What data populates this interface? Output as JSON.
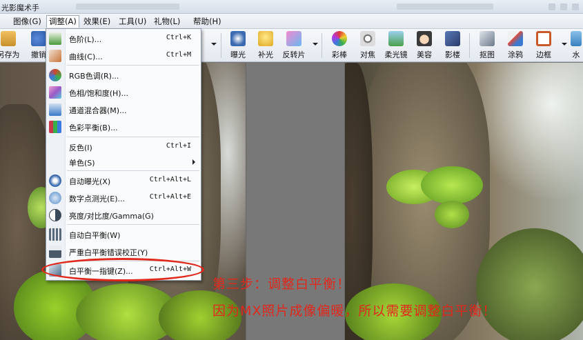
{
  "window": {
    "title": "光影魔术手"
  },
  "menubar": {
    "items": [
      {
        "label": "图像(G)"
      },
      {
        "label": "调整(A)"
      },
      {
        "label": "效果(E)"
      },
      {
        "label": "工具(U)"
      },
      {
        "label": "礼物(L)"
      },
      {
        "label": "帮助(H)"
      }
    ]
  },
  "toolbar": {
    "left": [
      {
        "label": "另存为",
        "icon": "save-icon"
      },
      {
        "label": "撤销",
        "icon": "undo-icon"
      }
    ],
    "right": [
      {
        "label": "曝光",
        "icon": "exposure-icon"
      },
      {
        "label": "补光",
        "icon": "fill-light-icon"
      },
      {
        "label": "反转片",
        "icon": "reversal-film-icon"
      },
      {
        "label": "彩棒",
        "icon": "color-stick-icon"
      },
      {
        "label": "对焦",
        "icon": "focus-icon"
      },
      {
        "label": "柔光镜",
        "icon": "soft-filter-icon"
      },
      {
        "label": "美容",
        "icon": "beauty-icon"
      },
      {
        "label": "影楼",
        "icon": "studio-icon"
      },
      {
        "label": "抠图",
        "icon": "cutout-icon"
      },
      {
        "label": "涂鸦",
        "icon": "doodle-icon"
      },
      {
        "label": "边框",
        "icon": "frame-icon"
      },
      {
        "label": "水",
        "icon": "watermark-icon"
      }
    ]
  },
  "dropdown": {
    "items": [
      {
        "label": "色阶(L)...",
        "shortcut": "Ctrl+K",
        "icon": "levels-icon",
        "color": "#4a9a3a"
      },
      {
        "label": "曲线(C)...",
        "shortcut": "Ctrl+M",
        "icon": "curves-icon",
        "color": "#c7743a"
      },
      {
        "label": "RGB色调(R)...",
        "shortcut": "",
        "icon": "rgb-icon",
        "color": "#d0442c"
      },
      {
        "label": "色相/饱和度(H)...",
        "shortcut": "",
        "icon": "hue-saturation-icon",
        "color": "#9a5ac8"
      },
      {
        "label": "通道混合器(M)...",
        "shortcut": "",
        "icon": "channel-mixer-icon",
        "color": "#3a7ac8"
      },
      {
        "label": "色彩平衡(B)...",
        "shortcut": "",
        "icon": "color-balance-icon",
        "color": "#c83a4a"
      },
      {
        "label": "反色(I)",
        "shortcut": "Ctrl+I",
        "icon": "",
        "color": ""
      },
      {
        "label": "单色(S)",
        "shortcut": "",
        "icon": "",
        "color": "",
        "submenu": true
      },
      {
        "label": "自动曝光(X)",
        "shortcut": "Ctrl+Alt+L",
        "icon": "auto-exposure-icon",
        "color": "#3a6ab0"
      },
      {
        "label": "数字点测光(E)...",
        "shortcut": "Ctrl+Alt+E",
        "icon": "spot-meter-icon",
        "color": "#5a8ac8"
      },
      {
        "label": "亮度/对比度/Gamma(G)",
        "shortcut": "",
        "icon": "brightness-contrast-icon",
        "color": "#3a4a5a"
      },
      {
        "label": "自动白平衡(W)",
        "shortcut": "",
        "icon": "auto-white-balance-icon",
        "color": "#5a6a7a"
      },
      {
        "label": "严重白平衡错误校正(Y)",
        "shortcut": "",
        "icon": "wb-correction-icon",
        "color": "#4a5a6a"
      },
      {
        "label": "白平衡一指键(Z)...",
        "shortcut": "Ctrl+Alt+W",
        "icon": "wb-one-click-icon",
        "color": "#4a6a8a"
      }
    ]
  },
  "annotation": {
    "step": "第三步：调整白平衡！",
    "reason": "因为MX照片成像偏暖，所以需要调整白平衡！"
  }
}
